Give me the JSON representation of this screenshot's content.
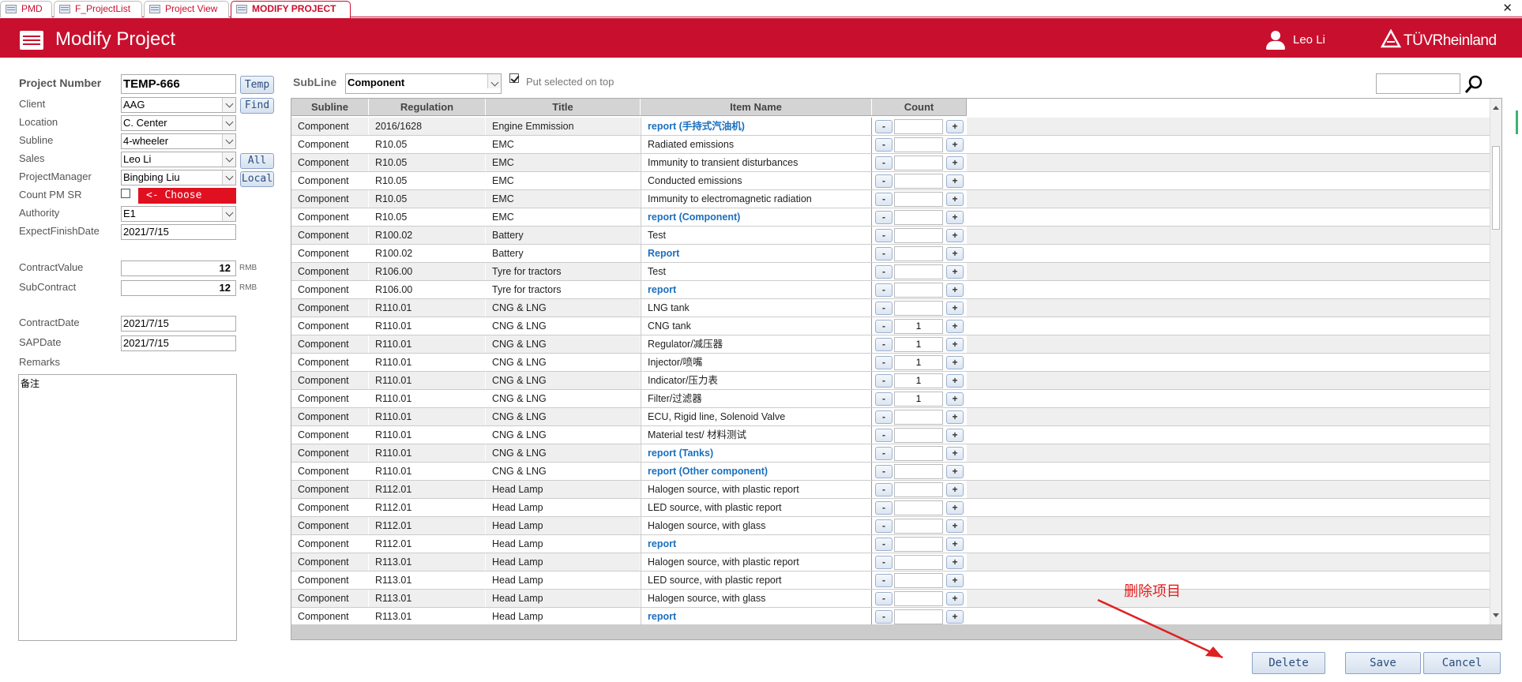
{
  "tabs": [
    {
      "label": "PMD"
    },
    {
      "label": "F_ProjectList"
    },
    {
      "label": "Project View"
    },
    {
      "label": "MODIFY PROJECT"
    }
  ],
  "header": {
    "title": "Modify Project",
    "user": "Leo Li",
    "logo": "TÜVRheinland"
  },
  "form": {
    "project_number_label": "Project Number",
    "project_number": "TEMP-666",
    "temp_button": "Temp",
    "client_label": "Client",
    "client": "AAG",
    "find_button": "Find",
    "location_label": "Location",
    "location": "C. Center",
    "subline_label": "Subline",
    "subline": "4-wheeler",
    "sales_label": "Sales",
    "sales": "Leo Li",
    "all_button": "All",
    "pm_label": "ProjectManager",
    "pm": "Bingbing Liu",
    "local_button": "Local",
    "count_pm_label": "Count PM SR",
    "choose_label": "<- Choose",
    "authority_label": "Authority",
    "authority": "E1",
    "expect_label": "ExpectFinishDate",
    "expect": "2021/7/15",
    "contract_value_label": "ContractValue",
    "contract_value": "12",
    "rmb1": "RMB",
    "subcontract_label": "SubContract",
    "subcontract": "12",
    "rmb2": "RMB",
    "contract_date_label": "ContractDate",
    "contract_date": "2021/7/15",
    "sap_date_label": "SAPDate",
    "sap_date": "2021/7/15",
    "remarks_label": "Remarks",
    "remarks": "备注"
  },
  "filter": {
    "subline_label": "SubLine",
    "subline_value": "Component",
    "put_on_top": "Put selected on top",
    "search_value": ""
  },
  "table": {
    "headers": [
      "Subline",
      "Regulation",
      "Title",
      "Item Name",
      "Count"
    ],
    "rows": [
      {
        "subline": "Component",
        "regulation": "2016/1628",
        "title": "Engine Emmission",
        "item": "report (手持式汽油机)",
        "link": true,
        "count": ""
      },
      {
        "subline": "Component",
        "regulation": "R10.05",
        "title": "EMC",
        "item": "Radiated emissions",
        "link": false,
        "count": ""
      },
      {
        "subline": "Component",
        "regulation": "R10.05",
        "title": "EMC",
        "item": "Immunity to transient disturbances",
        "link": false,
        "count": ""
      },
      {
        "subline": "Component",
        "regulation": "R10.05",
        "title": "EMC",
        "item": "Conducted emissions",
        "link": false,
        "count": ""
      },
      {
        "subline": "Component",
        "regulation": "R10.05",
        "title": "EMC",
        "item": "Immunity to electromagnetic radiation",
        "link": false,
        "count": ""
      },
      {
        "subline": "Component",
        "regulation": "R10.05",
        "title": "EMC",
        "item": "report (Component)",
        "link": true,
        "count": ""
      },
      {
        "subline": "Component",
        "regulation": "R100.02",
        "title": "Battery",
        "item": "Test",
        "link": false,
        "count": ""
      },
      {
        "subline": "Component",
        "regulation": "R100.02",
        "title": "Battery",
        "item": "Report",
        "link": true,
        "count": ""
      },
      {
        "subline": "Component",
        "regulation": "R106.00",
        "title": "Tyre for tractors",
        "item": "Test",
        "link": false,
        "count": ""
      },
      {
        "subline": "Component",
        "regulation": "R106.00",
        "title": "Tyre for tractors",
        "item": "report",
        "link": true,
        "count": ""
      },
      {
        "subline": "Component",
        "regulation": "R110.01",
        "title": "CNG & LNG",
        "item": "LNG tank",
        "link": false,
        "count": ""
      },
      {
        "subline": "Component",
        "regulation": "R110.01",
        "title": "CNG & LNG",
        "item": "CNG tank",
        "link": false,
        "count": "1"
      },
      {
        "subline": "Component",
        "regulation": "R110.01",
        "title": "CNG & LNG",
        "item": "Regulator/减压器",
        "link": false,
        "count": "1"
      },
      {
        "subline": "Component",
        "regulation": "R110.01",
        "title": "CNG & LNG",
        "item": "Injector/喷嘴",
        "link": false,
        "count": "1"
      },
      {
        "subline": "Component",
        "regulation": "R110.01",
        "title": "CNG & LNG",
        "item": "Indicator/压力表",
        "link": false,
        "count": "1"
      },
      {
        "subline": "Component",
        "regulation": "R110.01",
        "title": "CNG & LNG",
        "item": "Filter/过滤器",
        "link": false,
        "count": "1"
      },
      {
        "subline": "Component",
        "regulation": "R110.01",
        "title": "CNG & LNG",
        "item": "ECU, Rigid line, Solenoid Valve",
        "link": false,
        "count": ""
      },
      {
        "subline": "Component",
        "regulation": "R110.01",
        "title": "CNG & LNG",
        "item": "Material test/ 材料测试",
        "link": false,
        "count": ""
      },
      {
        "subline": "Component",
        "regulation": "R110.01",
        "title": "CNG & LNG",
        "item": "report (Tanks)",
        "link": true,
        "count": ""
      },
      {
        "subline": "Component",
        "regulation": "R110.01",
        "title": "CNG & LNG",
        "item": "report (Other component)",
        "link": true,
        "count": ""
      },
      {
        "subline": "Component",
        "regulation": "R112.01",
        "title": "Head Lamp",
        "item": "Halogen source, with plastic report",
        "link": false,
        "count": ""
      },
      {
        "subline": "Component",
        "regulation": "R112.01",
        "title": "Head Lamp",
        "item": "LED source, with plastic report",
        "link": false,
        "count": ""
      },
      {
        "subline": "Component",
        "regulation": "R112.01",
        "title": "Head Lamp",
        "item": "Halogen source, with glass",
        "link": false,
        "count": ""
      },
      {
        "subline": "Component",
        "regulation": "R112.01",
        "title": "Head Lamp",
        "item": "report",
        "link": true,
        "count": ""
      },
      {
        "subline": "Component",
        "regulation": "R113.01",
        "title": "Head Lamp",
        "item": "Halogen source, with plastic report",
        "link": false,
        "count": ""
      },
      {
        "subline": "Component",
        "regulation": "R113.01",
        "title": "Head Lamp",
        "item": "LED source, with plastic report",
        "link": false,
        "count": ""
      },
      {
        "subline": "Component",
        "regulation": "R113.01",
        "title": "Head Lamp",
        "item": "Halogen source, with glass",
        "link": false,
        "count": ""
      },
      {
        "subline": "Component",
        "regulation": "R113.01",
        "title": "Head Lamp",
        "item": "report",
        "link": true,
        "count": ""
      }
    ],
    "minus": "-",
    "plus": "+"
  },
  "buttons": {
    "delete": "Delete",
    "save": "Save",
    "cancel": "Cancel"
  },
  "annotation": "删除项目",
  "colors": {
    "brand": "#c8102e",
    "link": "#1a6fbf",
    "annotation": "#e02020"
  }
}
